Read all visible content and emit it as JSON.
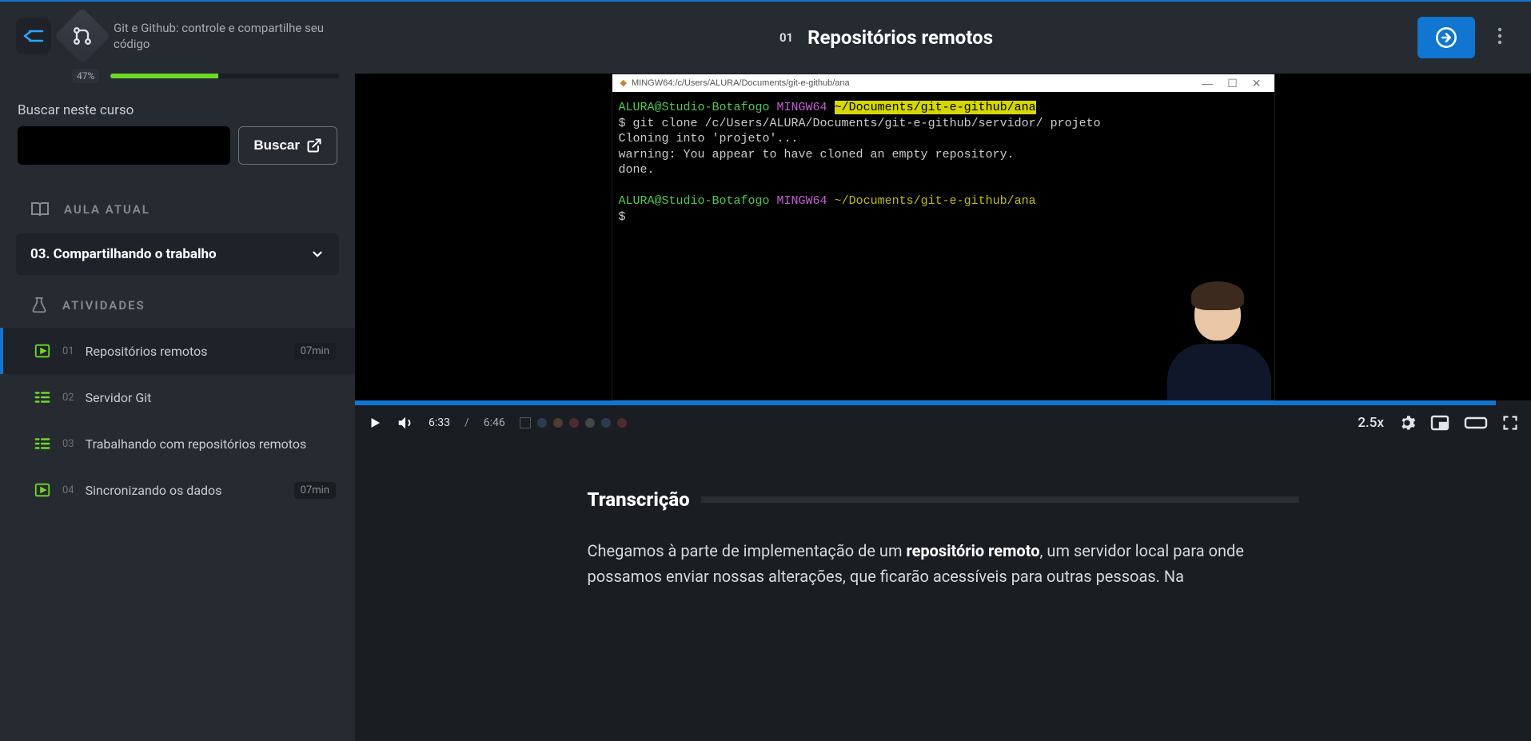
{
  "sidebar": {
    "course_title": "Git e Github: controle e compartilhe seu código",
    "progress_pct": "47%",
    "progress_fill": "47%",
    "search_label": "Buscar neste curso",
    "search_btn": "Buscar",
    "section_aula": "AULA ATUAL",
    "current_lesson": "03. Compartilhando o trabalho",
    "section_atividades": "ATIVIDADES",
    "activities": [
      {
        "num": "01",
        "title": "Repositórios remotos",
        "dur": "07min",
        "type": "video",
        "active": true
      },
      {
        "num": "02",
        "title": "Servidor Git",
        "dur": "",
        "type": "task",
        "active": false
      },
      {
        "num": "03",
        "title": "Trabalhando com repositórios remotos",
        "dur": "",
        "type": "task",
        "active": false
      },
      {
        "num": "04",
        "title": "Sincronizando os dados",
        "dur": "07min",
        "type": "video",
        "active": false
      }
    ]
  },
  "topbar": {
    "num": "01",
    "title": "Repositórios remotos"
  },
  "video": {
    "term_title": "MINGW64:/c/Users/ALURA/Documents/git-e-github/ana",
    "prompt_user": "ALURA@Studio-Botafogo",
    "prompt_env": "MINGW64",
    "prompt_path": "~/Documents/git-e-github/ana",
    "cmd": "$ git clone /c/Users/ALURA/Documents/git-e-github/servidor/ projeto",
    "out1": "Cloning into 'projeto'...",
    "out2": "warning: You appear to have cloned an empty repository.",
    "out3": "done.",
    "prompt2": "$",
    "time_cur": "6:33",
    "time_sep": "/",
    "time_dur": "6:46",
    "speed": "2.5x",
    "progress_pct": "97%"
  },
  "transcript": {
    "heading": "Transcrição",
    "p1a": "Chegamos à parte de implementação de um ",
    "p1b": "repositório remoto",
    "p1c": ", um servidor local para onde possamos enviar nossas alterações, que ficarão acessíveis para outras pessoas. Na"
  }
}
